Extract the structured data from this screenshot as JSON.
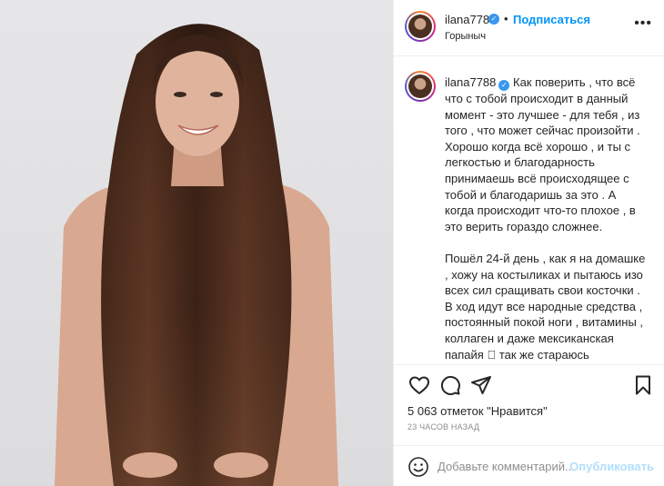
{
  "post": {
    "image_alt": "photo",
    "colors": {
      "accent": "#0095f6",
      "verified": "#3897f0",
      "muted": "#8e8e8e",
      "publish_disabled": "#b2dffc"
    }
  },
  "header": {
    "username": "ilana7788",
    "follow_label": "Подписаться",
    "location": "Горыныч",
    "more_icon": "more-horizontal-icon"
  },
  "caption": {
    "username": "ilana7788",
    "paragraphs": [
      "Как поверить , что всё что с тобой происходит в данный момент - это лучшее - для тебя , из того , что может сейчас произойти . Хорошо когда всё хорошо , и ты с легкостью и благодарность принимаешь всё происходящее с тобой и благодаришь за это . А когда происходит что-то плохое , в это верить гораздо сложнее.",
      "Пошёл 24-й день , как я на домашке , хожу на костыликах и пытаюсь изо всех сил сращивать свои косточки . В ход идут все народные средства , постоянный покой ноги , витамины , коллаген и даже мексиканская папайя 🏻 так же стараюсь сохранять позитивный настрой и твёрдо верить , что - то , что со мной"
    ]
  },
  "actions": {
    "like_icon": "heart-icon",
    "comment_icon": "comment-icon",
    "share_icon": "share-icon",
    "save_icon": "bookmark-icon"
  },
  "likes_text": "5 063 отметок \"Нравится\"",
  "time_text": "23 ЧАСОВ НАЗАД",
  "comment": {
    "placeholder": "Добавьте комментарий...",
    "publish_label": "Опубликовать",
    "emoji_icon": "emoji-icon"
  }
}
